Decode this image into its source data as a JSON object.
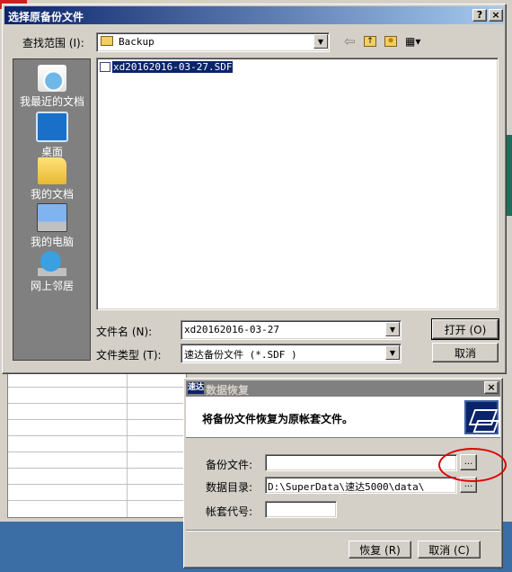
{
  "open_dialog": {
    "title": "选择原备份文件",
    "help_icon": "?",
    "close_icon": "×",
    "look_in_label": "查找范围 (I):",
    "look_in_value": "Backup",
    "places": [
      {
        "label": "我最近的文档",
        "icon": "recent-documents-icon"
      },
      {
        "label": "桌面",
        "icon": "desktop-icon"
      },
      {
        "label": "我的文档",
        "icon": "my-documents-icon"
      },
      {
        "label": "我的电脑",
        "icon": "my-computer-icon"
      },
      {
        "label": "网上邻居",
        "icon": "network-places-icon"
      }
    ],
    "files": [
      {
        "name": "xd20162016-03-27.SDF",
        "selected": true
      }
    ],
    "filename_label": "文件名 (N):",
    "filename_value": "xd20162016-03-27",
    "filetype_label": "文件类型 (T):",
    "filetype_value": "速达备份文件 (*.SDF )",
    "open_button": "打开 (O)",
    "cancel_button": "取消"
  },
  "restore_dialog": {
    "title": "数据恢复",
    "title_icon_text": "速达",
    "description": "将备份文件恢复为原帐套文件。",
    "backup_file_label": "备份文件:",
    "backup_file_value": "",
    "data_dir_label": "数据目录:",
    "data_dir_value": "D:\\SuperData\\速达5000\\data\\",
    "account_code_label": "帐套代号:",
    "account_code_value": "",
    "browse_label": "...",
    "restore_button": "恢复 (R)",
    "cancel_button": "取消 (C)",
    "close_icon": "×"
  },
  "colors": {
    "desktop": "#3a6ea5",
    "title_active": "#0a246a",
    "title_inactive": "#808080",
    "face": "#d4d0c8",
    "highlight_circle": "#e00000"
  }
}
